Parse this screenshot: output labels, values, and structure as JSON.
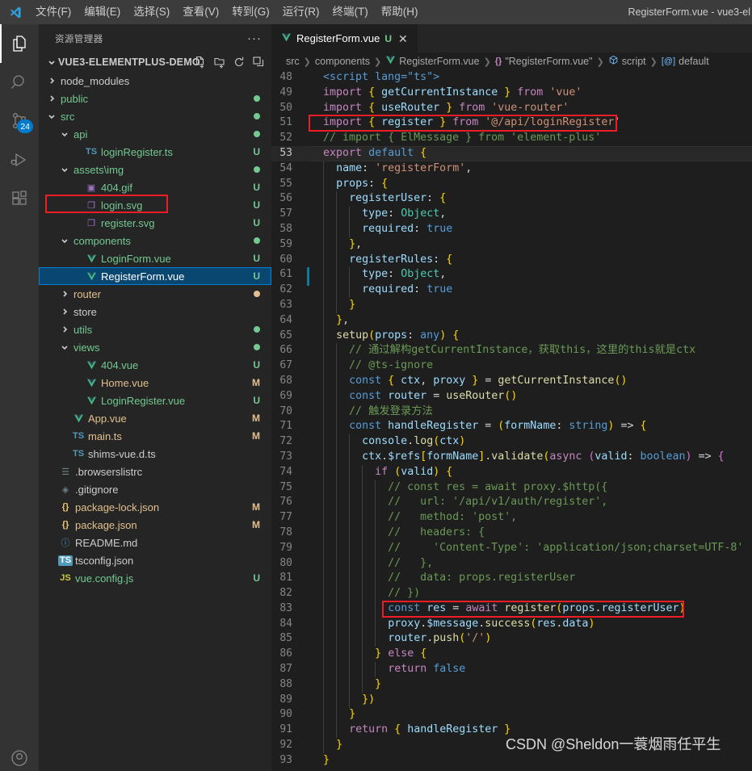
{
  "titlebar": {
    "logo": "vscode-logo",
    "menus": [
      "文件(F)",
      "编辑(E)",
      "选择(S)",
      "查看(V)",
      "转到(G)",
      "运行(R)",
      "终端(T)",
      "帮助(H)"
    ],
    "window_title": "RegisterForm.vue - vue3-el"
  },
  "activitybar": {
    "items": [
      {
        "name": "explorer",
        "icon": "files-icon",
        "active": true,
        "badge": ""
      },
      {
        "name": "search",
        "icon": "search-icon",
        "active": false,
        "badge": ""
      },
      {
        "name": "source-control",
        "icon": "source-control-icon",
        "active": false,
        "badge": "24"
      },
      {
        "name": "run-and-debug",
        "icon": "run-debug-icon",
        "active": false,
        "badge": ""
      },
      {
        "name": "extensions",
        "icon": "extensions-icon",
        "active": false,
        "badge": ""
      }
    ],
    "bottom": [
      {
        "name": "accounts",
        "icon": "account-icon"
      }
    ]
  },
  "sidebar": {
    "title": "资源管理器",
    "more_actions": "···",
    "root": {
      "label": "VUE3-ELEMENTPLUS-DEMO",
      "expanded": true,
      "actions": [
        "new-file-icon",
        "new-folder-icon",
        "refresh-icon",
        "collapse-all-icon"
      ]
    },
    "tree": [
      {
        "label": "node_modules",
        "kind": "folder",
        "depth": 1,
        "expanded": false,
        "status": "",
        "color": "default"
      },
      {
        "label": "public",
        "kind": "folder",
        "depth": 1,
        "expanded": false,
        "status": "dot-green",
        "color": "green"
      },
      {
        "label": "src",
        "kind": "folder",
        "depth": 1,
        "expanded": true,
        "status": "dot-green",
        "color": "green"
      },
      {
        "label": "api",
        "kind": "folder",
        "depth": 2,
        "expanded": true,
        "status": "dot-green",
        "color": "green"
      },
      {
        "label": "loginRegister.ts",
        "kind": "ts",
        "depth": 3,
        "status": "U",
        "color": "green"
      },
      {
        "label": "assets\\img",
        "kind": "folder",
        "depth": 2,
        "expanded": true,
        "status": "dot-green",
        "color": "green"
      },
      {
        "label": "404.gif",
        "kind": "image",
        "depth": 3,
        "status": "U",
        "color": "green"
      },
      {
        "label": "login.svg",
        "kind": "svg",
        "depth": 3,
        "status": "U",
        "color": "green"
      },
      {
        "label": "register.svg",
        "kind": "svg",
        "depth": 3,
        "status": "U",
        "color": "green"
      },
      {
        "label": "components",
        "kind": "folder",
        "depth": 2,
        "expanded": true,
        "status": "dot-green",
        "color": "green"
      },
      {
        "label": "LoginForm.vue",
        "kind": "vue",
        "depth": 3,
        "status": "U",
        "color": "green"
      },
      {
        "label": "RegisterForm.vue",
        "kind": "vue",
        "depth": 3,
        "status": "U",
        "color": "white",
        "selected": true,
        "highlighted": true
      },
      {
        "label": "router",
        "kind": "folder",
        "depth": 2,
        "expanded": false,
        "status": "dot-orange",
        "color": "orange"
      },
      {
        "label": "store",
        "kind": "folder",
        "depth": 2,
        "expanded": false,
        "status": "",
        "color": "default"
      },
      {
        "label": "utils",
        "kind": "folder",
        "depth": 2,
        "expanded": false,
        "status": "dot-green",
        "color": "green"
      },
      {
        "label": "views",
        "kind": "folder",
        "depth": 2,
        "expanded": true,
        "status": "dot-green",
        "color": "green"
      },
      {
        "label": "404.vue",
        "kind": "vue",
        "depth": 3,
        "status": "U",
        "color": "green"
      },
      {
        "label": "Home.vue",
        "kind": "vue",
        "depth": 3,
        "status": "M",
        "color": "orange"
      },
      {
        "label": "LoginRegister.vue",
        "kind": "vue",
        "depth": 3,
        "status": "U",
        "color": "green"
      },
      {
        "label": "App.vue",
        "kind": "vue",
        "depth": 2,
        "status": "M",
        "color": "orange"
      },
      {
        "label": "main.ts",
        "kind": "ts",
        "depth": 2,
        "status": "M",
        "color": "orange"
      },
      {
        "label": "shims-vue.d.ts",
        "kind": "ts",
        "depth": 2,
        "status": "",
        "color": "default"
      },
      {
        "label": ".browserslistrc",
        "kind": "config",
        "depth": 1,
        "status": "",
        "color": "default"
      },
      {
        "label": ".gitignore",
        "kind": "git",
        "depth": 1,
        "status": "",
        "color": "default"
      },
      {
        "label": "package-lock.json",
        "kind": "json",
        "depth": 1,
        "status": "M",
        "color": "orange"
      },
      {
        "label": "package.json",
        "kind": "json",
        "depth": 1,
        "status": "M",
        "color": "orange"
      },
      {
        "label": "README.md",
        "kind": "md",
        "depth": 1,
        "status": "",
        "color": "default"
      },
      {
        "label": "tsconfig.json",
        "kind": "tsjson",
        "depth": 1,
        "status": "",
        "color": "default"
      },
      {
        "label": "vue.config.js",
        "kind": "js",
        "depth": 1,
        "status": "U",
        "color": "green"
      }
    ]
  },
  "editor": {
    "tab": {
      "icon": "vue-icon",
      "name": "RegisterForm.vue",
      "status": "U",
      "close": "✕"
    },
    "breadcrumb": [
      {
        "label": "src",
        "icon": ""
      },
      {
        "label": "components",
        "icon": ""
      },
      {
        "label": "RegisterForm.vue",
        "icon": "vue-icon"
      },
      {
        "label": "\"RegisterForm.vue\"",
        "icon": "json-braces-icon"
      },
      {
        "label": "script",
        "icon": "cube-icon"
      },
      {
        "label": "default",
        "icon": "at-symbol-icon"
      }
    ],
    "current_line": 53,
    "lines": [
      {
        "n": 48,
        "t": "  <script lang=\"ts\">"
      },
      {
        "n": 49,
        "t": "  import { getCurrentInstance } from 'vue'"
      },
      {
        "n": 50,
        "t": "  import { useRouter } from 'vue-router'"
      },
      {
        "n": 51,
        "t": "  import { register } from '@/api/loginRegister'"
      },
      {
        "n": 52,
        "t": "  // import { ElMessage } from 'element-plus'"
      },
      {
        "n": 53,
        "t": "  export default {"
      },
      {
        "n": 54,
        "t": "    name: 'registerForm',"
      },
      {
        "n": 55,
        "t": "    props: {"
      },
      {
        "n": 56,
        "t": "      registerUser: {"
      },
      {
        "n": 57,
        "t": "        type: Object,"
      },
      {
        "n": 58,
        "t": "        required: true"
      },
      {
        "n": 59,
        "t": "      },"
      },
      {
        "n": 60,
        "t": "      registerRules: {"
      },
      {
        "n": 61,
        "t": "        type: Object,"
      },
      {
        "n": 62,
        "t": "        required: true"
      },
      {
        "n": 63,
        "t": "      }"
      },
      {
        "n": 64,
        "t": "    },"
      },
      {
        "n": 65,
        "t": "    setup(props: any) {"
      },
      {
        "n": 66,
        "t": "      // 通过解构getCurrentInstance，获取this，这里的this就是ctx"
      },
      {
        "n": 67,
        "t": "      // @ts-ignore"
      },
      {
        "n": 68,
        "t": "      const { ctx, proxy } = getCurrentInstance()"
      },
      {
        "n": 69,
        "t": "      const router = useRouter()"
      },
      {
        "n": 70,
        "t": "      // 触发登录方法"
      },
      {
        "n": 71,
        "t": "      const handleRegister = (formName: string) => {"
      },
      {
        "n": 72,
        "t": "        console.log(ctx)"
      },
      {
        "n": 73,
        "t": "        ctx.$refs[formName].validate(async (valid: boolean) => {"
      },
      {
        "n": 74,
        "t": "          if (valid) {"
      },
      {
        "n": 75,
        "t": "            // const res = await proxy.$http({"
      },
      {
        "n": 76,
        "t": "            //   url: '/api/v1/auth/register',"
      },
      {
        "n": 77,
        "t": "            //   method: 'post',"
      },
      {
        "n": 78,
        "t": "            //   headers: {"
      },
      {
        "n": 79,
        "t": "            //     'Content-Type': 'application/json;charset=UTF-8'"
      },
      {
        "n": 80,
        "t": "            //   },"
      },
      {
        "n": 81,
        "t": "            //   data: props.registerUser"
      },
      {
        "n": 82,
        "t": "            // })"
      },
      {
        "n": 83,
        "t": "            const res = await register(props.registerUser)"
      },
      {
        "n": 84,
        "t": "            proxy.$message.success(res.data)"
      },
      {
        "n": 85,
        "t": "            router.push('/')"
      },
      {
        "n": 86,
        "t": "          } else {"
      },
      {
        "n": 87,
        "t": "            return false"
      },
      {
        "n": 88,
        "t": "          }"
      },
      {
        "n": 89,
        "t": "        })"
      },
      {
        "n": 90,
        "t": "      }"
      },
      {
        "n": 91,
        "t": "      return { handleRegister }"
      },
      {
        "n": 92,
        "t": "    }"
      },
      {
        "n": 93,
        "t": "  }"
      }
    ],
    "annotations": [
      {
        "name": "highlight-import-register",
        "line": 51
      },
      {
        "name": "highlight-register-call",
        "line": 83
      }
    ]
  },
  "watermark": "CSDN @Sheldon一蓑烟雨任平生",
  "colors": {
    "accent": "#007acc",
    "annotation_red": "#ee1c25",
    "selection_blue": "#094771",
    "status_untracked": "#73c991",
    "status_modified": "#e2c08d"
  }
}
